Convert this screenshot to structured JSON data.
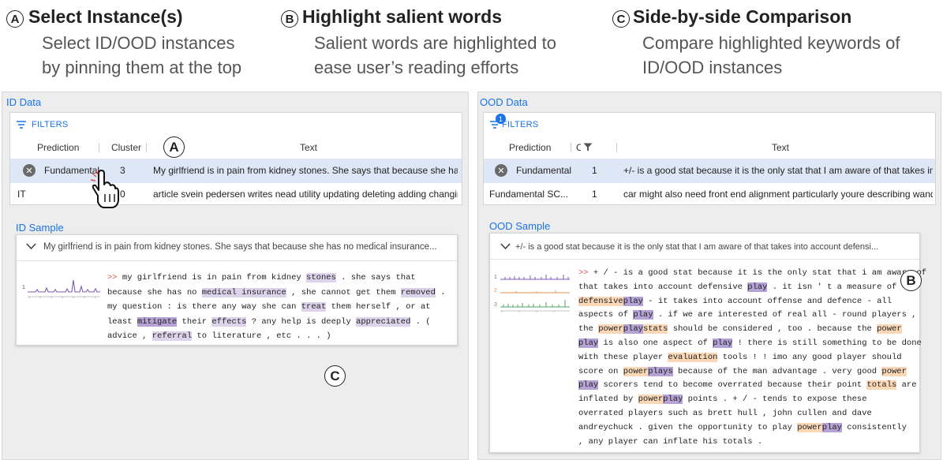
{
  "annotations": {
    "a": {
      "letter": "A",
      "title": "Select Instance(s)",
      "desc1": "Select ID/OOD instances",
      "desc2": "by pinning them at the top"
    },
    "b": {
      "letter": "B",
      "title": "Highlight salient words",
      "desc1": "Salient words are highlighted to",
      "desc2": "ease user’s reading efforts"
    },
    "c": {
      "letter": "C",
      "title": "Side-by-side Comparison",
      "desc1": "Compare highlighted keywords of",
      "desc2": "ID/OOD instances"
    }
  },
  "id_panel": {
    "title": "ID Data",
    "filters_label": "FILTERS",
    "columns": [
      "Prediction",
      "Cluster",
      "Text"
    ],
    "rows": [
      {
        "prediction": "Fundamental",
        "cluster": "3",
        "text": "My girlfriend is in pain from kidney stones. She says that because she has..."
      },
      {
        "prediction": "IT",
        "cluster": "0",
        "text": "article svein pedersen writes nead utility updating deleting adding changin..."
      }
    ],
    "sample_title": "ID Sample",
    "sample_header": "My girlfriend is in pain from kidney stones. She says that because she has no medical insurance...",
    "chart_label": "1"
  },
  "ood_panel": {
    "title": "OOD Data",
    "filters_label": "FILTERS",
    "filter_badge": "1",
    "columns": [
      "Prediction",
      "C",
      "Text"
    ],
    "rows": [
      {
        "prediction": "Fundamental",
        "cluster": "1",
        "text": "+/- is a good stat because it is the only stat that I am aware of that takes in..."
      },
      {
        "prediction": "Fundamental SC...",
        "cluster": "1",
        "text": "car might also need front end alignment particularly youre describing wand..."
      }
    ],
    "sample_title": "OOD Sample",
    "sample_header": "+/- is a good stat because it is the only stat that I am aware of that takes into account defensi...",
    "chart_labels": [
      "1",
      "2",
      "3"
    ]
  },
  "id_text_lines": [
    [
      {
        "t": ">> ",
        "c": "arrow"
      },
      {
        "t": "my girlfriend is in pain from kidney "
      },
      {
        "t": "stones",
        "h": "p1"
      },
      {
        "t": " . she says that"
      }
    ],
    [
      {
        "t": "because she has no "
      },
      {
        "t": "medical insurance",
        "h": "p1"
      },
      {
        "t": " , she cannot get them "
      },
      {
        "t": "removed",
        "h": "p1"
      },
      {
        "t": " ."
      }
    ],
    [
      {
        "t": "my question : is there any way she can "
      },
      {
        "t": "treat",
        "h": "p1"
      },
      {
        "t": " them herself , or at"
      }
    ],
    [
      {
        "t": "least "
      },
      {
        "t": "mitigate",
        "h": "p2"
      },
      {
        "t": " their "
      },
      {
        "t": "effects",
        "h": "p1"
      },
      {
        "t": " ? any help is deeply "
      },
      {
        "t": "appreciated",
        "h": "p1"
      },
      {
        "t": " . ("
      }
    ],
    [
      {
        "t": "advice , "
      },
      {
        "t": "referral",
        "h": "p1"
      },
      {
        "t": " to literature , etc . . . )"
      }
    ]
  ],
  "ood_text_lines": [
    [
      {
        "t": ">> ",
        "c": "arrow"
      },
      {
        "t": "+ / - is a good stat because it is the only stat that i am aware of"
      }
    ],
    [
      {
        "t": "that takes into account defensive "
      },
      {
        "t": "play",
        "h": "p2"
      },
      {
        "t": " . it isn ' t a measure of"
      }
    ],
    [
      {
        "t": "defensive",
        "h": "o1"
      },
      {
        "t": "play",
        "h": "p2"
      },
      {
        "t": " - it takes into account offense and defence - all"
      }
    ],
    [
      {
        "t": "aspects of "
      },
      {
        "t": "play",
        "h": "p2"
      },
      {
        "t": " . if we are interested of real all - round players ,"
      }
    ],
    [
      {
        "t": "the "
      },
      {
        "t": "power",
        "h": "o1"
      },
      {
        "t": "play",
        "h": "p2"
      },
      {
        "t": "stats",
        "h": "o1"
      },
      {
        "t": " should be considered , too . because the "
      },
      {
        "t": "power",
        "h": "o1"
      }
    ],
    [
      {
        "t": "play",
        "h": "p2"
      },
      {
        "t": " is also one aspect of "
      },
      {
        "t": "play",
        "h": "p2"
      },
      {
        "t": " ! there is still something to be done"
      }
    ],
    [
      {
        "t": "with these player "
      },
      {
        "t": "evaluation",
        "h": "o1"
      },
      {
        "t": " tools ! ! imo any good player should"
      }
    ],
    [
      {
        "t": "score on "
      },
      {
        "t": "power",
        "h": "o1"
      },
      {
        "t": "plays",
        "h": "p2"
      },
      {
        "t": " because of the man advantage . very good "
      },
      {
        "t": "power",
        "h": "o1"
      }
    ],
    [
      {
        "t": "play",
        "h": "p2"
      },
      {
        "t": " scorers tend to become overrated because their point "
      },
      {
        "t": "totals",
        "h": "o1"
      },
      {
        "t": " are"
      }
    ],
    [
      {
        "t": "inflated by "
      },
      {
        "t": "power",
        "h": "o1"
      },
      {
        "t": "play",
        "h": "p2"
      },
      {
        "t": " points . + / - tends to expose these"
      }
    ],
    [
      {
        "t": "overrated players such as brett hull , john cullen and dave"
      }
    ],
    [
      {
        "t": "andreychuck . given the opportunity to play "
      },
      {
        "t": "power",
        "h": "o1"
      },
      {
        "t": "play",
        "h": "p2"
      },
      {
        "t": " consistently"
      }
    ],
    [
      {
        "t": " , any player can inflate his totals ."
      }
    ]
  ],
  "marker_labels": {
    "a": "A",
    "b": "B",
    "c": "C"
  },
  "colors": {
    "accent": "#1a73e8",
    "purple_light": "#ddd4ec",
    "purple_dark": "#b6a3d6",
    "orange": "#f9d7b7",
    "chart1": "#7e5bb8",
    "chart2": "#e8914a",
    "chart3": "#4fa56a",
    "arrow": "#e05050"
  }
}
